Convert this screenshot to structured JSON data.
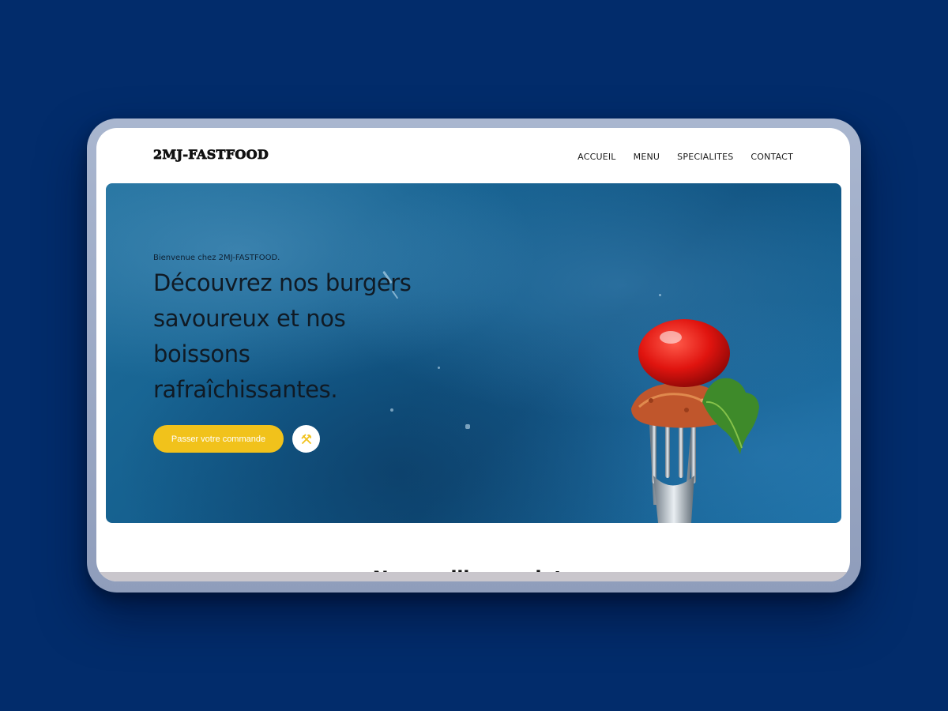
{
  "site": {
    "logo_text": "2MJ-FASTFOOD"
  },
  "nav": {
    "items": [
      "ACCUEIL",
      "MENU",
      "SPECIALITES",
      "CONTACT"
    ]
  },
  "hero": {
    "eyebrow": "Bienvenue chez 2MJ-FASTFOOD.",
    "title": "Découvrez nos burgers savoureux et nos boissons rafraîchissantes.",
    "cta_label": "Passer votre commande",
    "secondary_icon": "utensils-icon"
  },
  "section": {
    "heading": "Nos meilleurs plats"
  },
  "colors": {
    "page_background": "#022c6b",
    "accent": "#f1c21b",
    "hero_blue": "#15608f"
  }
}
